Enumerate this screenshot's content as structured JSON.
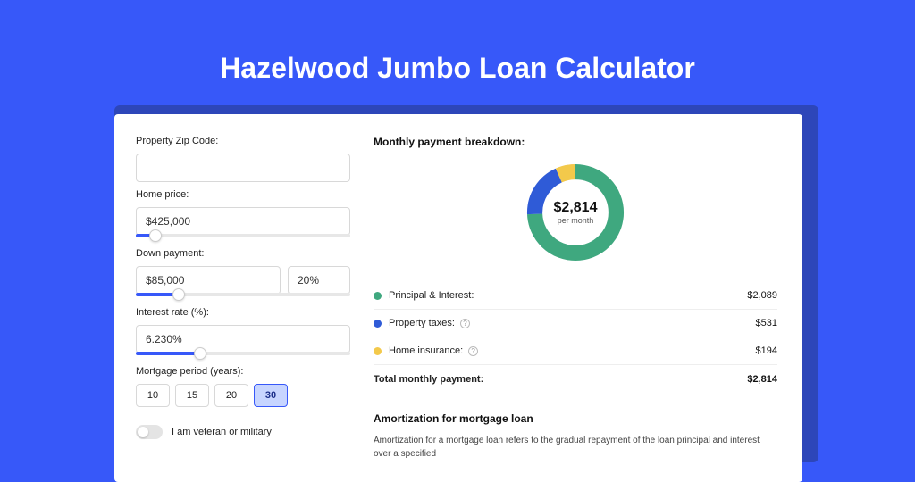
{
  "hero": {
    "title": "Hazelwood Jumbo Loan Calculator"
  },
  "form": {
    "zip_label": "Property Zip Code:",
    "zip_value": "",
    "home_price_label": "Home price:",
    "home_price_value": "$425,000",
    "home_price_slider_pct": 9,
    "down_payment_label": "Down payment:",
    "down_payment_value": "$85,000",
    "down_payment_pct_value": "20%",
    "down_payment_slider_pct": 20,
    "interest_label": "Interest rate (%):",
    "interest_value": "6.230%",
    "interest_slider_pct": 30,
    "period_label": "Mortgage period (years):",
    "period_options": [
      "10",
      "15",
      "20",
      "30"
    ],
    "period_selected": "30",
    "veteran_label": "I am veteran or military",
    "veteran_on": false
  },
  "breakdown": {
    "title": "Monthly payment breakdown:",
    "center_amount": "$2,814",
    "center_sub": "per month",
    "items": [
      {
        "label": "Principal & Interest:",
        "value": "$2,089",
        "color": "#3fa87f",
        "help": false
      },
      {
        "label": "Property taxes:",
        "value": "$531",
        "color": "#2f5bd7",
        "help": true
      },
      {
        "label": "Home insurance:",
        "value": "$194",
        "color": "#f3c94b",
        "help": true
      }
    ],
    "total_label": "Total monthly payment:",
    "total_value": "$2,814"
  },
  "amort": {
    "title": "Amortization for mortgage loan",
    "text": "Amortization for a mortgage loan refers to the gradual repayment of the loan principal and interest over a specified"
  },
  "chart_data": {
    "type": "pie",
    "title": "Monthly payment breakdown",
    "series": [
      {
        "name": "Principal & Interest",
        "value": 2089,
        "color": "#3fa87f"
      },
      {
        "name": "Property taxes",
        "value": 531,
        "color": "#2f5bd7"
      },
      {
        "name": "Home insurance",
        "value": 194,
        "color": "#f3c94b"
      }
    ],
    "total": 2814,
    "center_label": "$2,814 per month"
  }
}
